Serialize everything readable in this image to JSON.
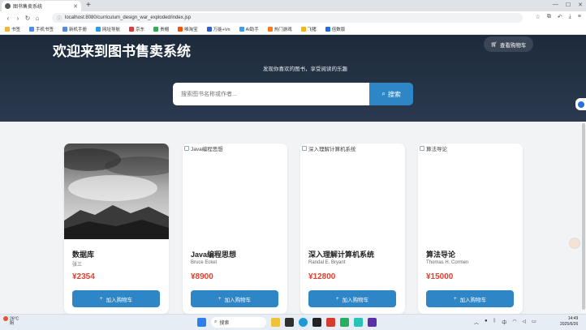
{
  "browser": {
    "tab_title": "图书售卖系统",
    "url": "localhost:8080/curriculum_design_war_exploded/index.jsp",
    "bookmarks": [
      {
        "label": "书签",
        "color": "#f2b632"
      },
      {
        "label": "手机书签",
        "color": "#4b8de8"
      },
      {
        "label": "新机手册",
        "color": "#4b8de8"
      },
      {
        "label": "网址导航",
        "color": "#2e9be6"
      },
      {
        "label": "京东",
        "color": "#e4393c"
      },
      {
        "label": "贵帽",
        "color": "#2bb24c"
      },
      {
        "label": "唯淘宝",
        "color": "#ff5000"
      },
      {
        "label": "万能+Vn",
        "color": "#2b5fd9"
      },
      {
        "label": "AI助手",
        "color": "#3aa0f0"
      },
      {
        "label": "热门游戏",
        "color": "#ff7a1a"
      },
      {
        "label": "飞猪",
        "color": "#ffb400"
      },
      {
        "label": "倍数版",
        "color": "#1f6fe0"
      }
    ]
  },
  "header": {
    "title": "欢迎来到图书售卖系统",
    "cart_label": "查看购物车",
    "subtitle": "发现你喜欢的图书，享受阅读的乐趣"
  },
  "search": {
    "placeholder": "搜索图书名称或作者...",
    "button_label": "搜索"
  },
  "books": [
    {
      "name": "数据库",
      "author": "张三",
      "price": "¥2354",
      "alt": "",
      "has_image": true
    },
    {
      "name": "Java编程思想",
      "author": "Bruce Eckel",
      "price": "¥8900",
      "alt": "Java编程思想",
      "has_image": false
    },
    {
      "name": "深入理解计算机系统",
      "author": "Randal E. Bryant",
      "price": "¥12800",
      "alt": "深入理解计算机系统",
      "has_image": false
    },
    {
      "name": "算法导论",
      "author": "Thomas H. Cormen",
      "price": "¥15000",
      "alt": "算法导论",
      "has_image": false
    }
  ],
  "add_to_cart_label": "加入购物车",
  "taskbar": {
    "weather_temp": "26°C",
    "weather_desc": "阴",
    "search_label": "搜索",
    "lang": "中",
    "time": "14:49",
    "date": "2025/6/26"
  }
}
